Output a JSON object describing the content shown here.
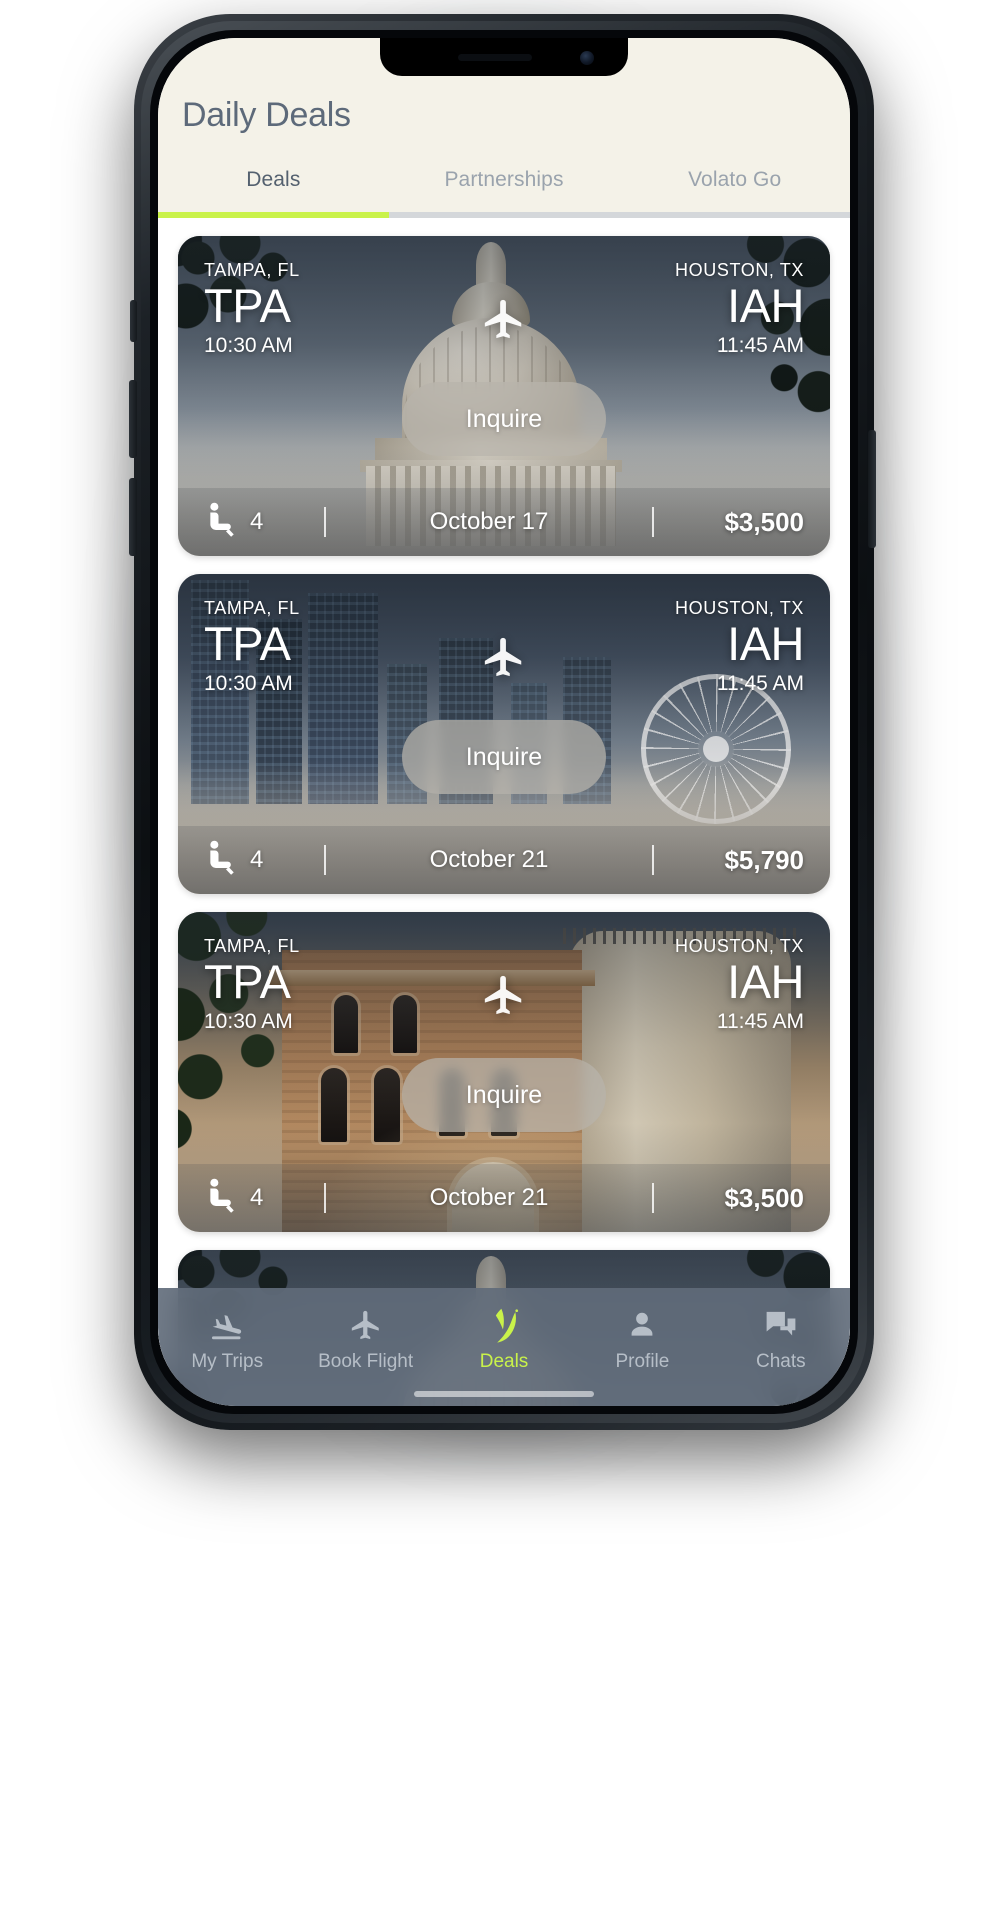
{
  "header": {
    "title": "Daily Deals",
    "tabs": [
      {
        "label": "Deals",
        "active": true
      },
      {
        "label": "Partnerships",
        "active": false
      },
      {
        "label": "Volato Go",
        "active": false
      }
    ]
  },
  "colors": {
    "accent_green": "#c9f24a",
    "header_bg": "#f4f2e8",
    "title_text": "#5d6a7a",
    "tab_inactive": "#9aa3ad",
    "nav_bar": "#606c7a"
  },
  "deals": [
    {
      "origin_city": "TAMPA, FL",
      "origin_code": "TPA",
      "origin_time": "10:30 AM",
      "dest_city": "HOUSTON, TX",
      "dest_code": "IAH",
      "dest_time": "11:45 AM",
      "cta_label": "Inquire",
      "seats": "4",
      "date": "October 17",
      "price": "$3,500",
      "art": "capitol"
    },
    {
      "origin_city": "TAMPA, FL",
      "origin_code": "TPA",
      "origin_time": "10:30 AM",
      "dest_city": "HOUSTON, TX",
      "dest_code": "IAH",
      "dest_time": "11:45 AM",
      "cta_label": "Inquire",
      "seats": "4",
      "date": "October 21",
      "price": "$5,790",
      "art": "houston"
    },
    {
      "origin_city": "TAMPA, FL",
      "origin_code": "TPA",
      "origin_time": "10:30 AM",
      "dest_city": "HOUSTON, TX",
      "dest_code": "IAH",
      "dest_time": "11:45 AM",
      "cta_label": "Inquire",
      "seats": "4",
      "date": "October 21",
      "price": "$3,500",
      "art": "brick"
    }
  ],
  "bottom_nav": [
    {
      "label": "My Trips",
      "icon": "flight-land-icon",
      "active": false
    },
    {
      "label": "Book Flight",
      "icon": "airplane-icon",
      "active": false
    },
    {
      "label": "Deals",
      "icon": "volato-leaf-logo",
      "active": true
    },
    {
      "label": "Profile",
      "icon": "person-icon",
      "active": false
    },
    {
      "label": "Chats",
      "icon": "chat-bubbles-icon",
      "active": false
    }
  ]
}
